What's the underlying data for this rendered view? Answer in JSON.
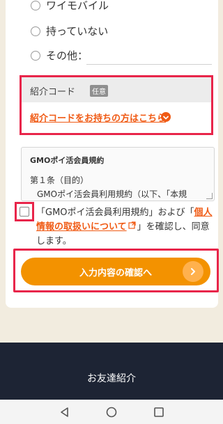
{
  "form": {
    "options": [
      "ワイモバイル",
      "持っていない",
      "その他："
    ]
  },
  "referral": {
    "label": "紹介コード",
    "badge": "任意",
    "link": "紹介コードをお持ちの方はこちら"
  },
  "terms": {
    "title": "GMOポイ活会員規約",
    "article": "第１条（目的）",
    "body": "GMOポイ活会員利用規約（以下、「本規"
  },
  "consent": {
    "pre": "「GMOポイ活会員利用規約」および「",
    "link": "個人情報の取扱いについて",
    "post": "」を確認し、同意します。"
  },
  "actions": {
    "confirm": "入力内容の確認へ"
  },
  "footer": {
    "link": "お友達紹介"
  },
  "colors": {
    "accent": "#f05a14",
    "button": "#f39200",
    "highlight": "#e8254a",
    "footer": "#1d2434"
  }
}
